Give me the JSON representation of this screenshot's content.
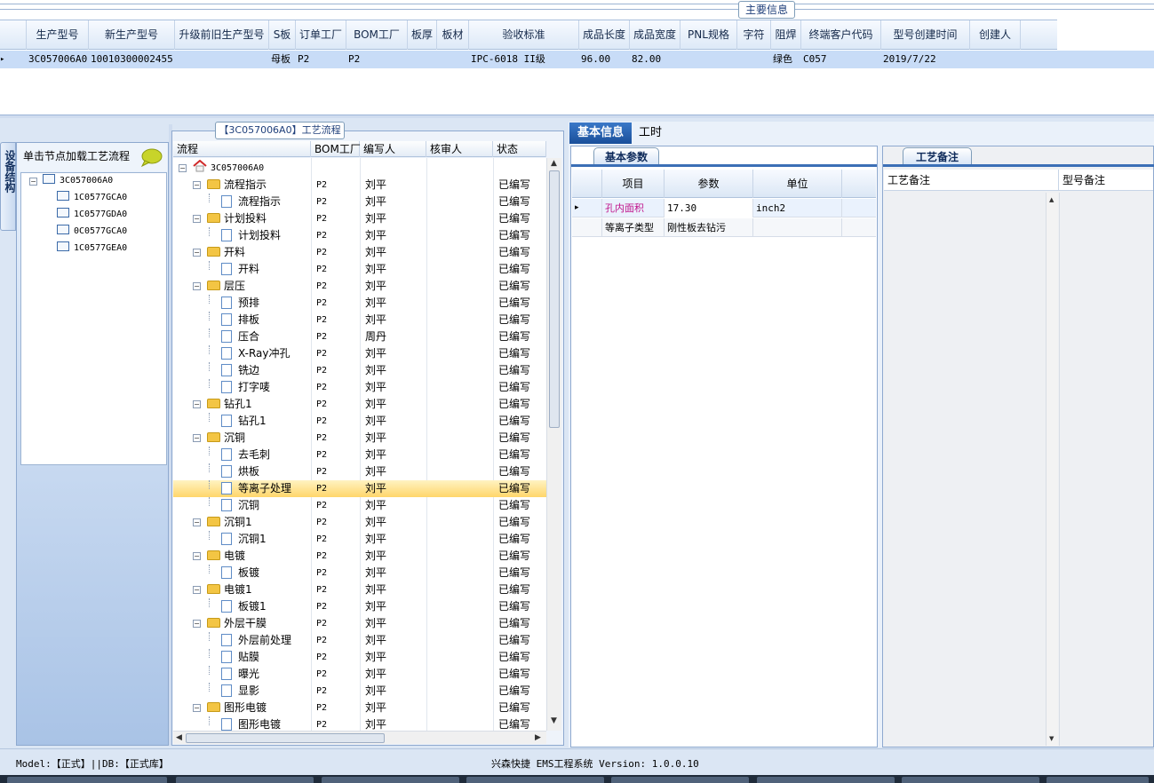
{
  "main_info": {
    "title": "主要信息",
    "columns": [
      "生产型号",
      "新生产型号",
      "升级前旧生产型号",
      "S板",
      "订单工厂",
      "BOM工厂",
      "板厚",
      "板材",
      "验收标准",
      "成品长度",
      "成品宽度",
      "PNL规格",
      "字符",
      "阻焊",
      "终端客户代码",
      "型号创建时间",
      "创建人"
    ],
    "row": {
      "生产型号": "3C057006A0",
      "新生产型号": "10010300002455",
      "升级前旧生产型号": "",
      "S板": "母板",
      "订单工厂": "P2",
      "BOM工厂": "P2",
      "板厚": "",
      "板材": "",
      "验收标准": "IPC-6018 II级",
      "成品长度": "96.00",
      "成品宽度": "82.00",
      "PNL规格": "",
      "字符": "",
      "阻焊": "绿色",
      "终端客户代码": "C057",
      "型号创建时间": "2019/7/22",
      "创建人": ""
    }
  },
  "left_panel": {
    "vertical_tab": "设备结构",
    "hint": "单击节点加载工艺流程",
    "tree": {
      "root": "3C057006A0",
      "children": [
        "1C0577GCA0",
        "1C0577GDA0",
        "0C0577GCA0",
        "1C0577GEA0"
      ]
    }
  },
  "flow": {
    "title": "【3C057006A0】工艺流程",
    "headers": [
      "流程",
      "BOM工厂",
      "编写人",
      "核审人",
      "状态"
    ],
    "root": "3C057006A0",
    "rows": [
      {
        "level": 1,
        "type": "folder",
        "name": "流程指示",
        "bom": "P2",
        "writer": "刘平",
        "reviewer": "",
        "status": "已编写"
      },
      {
        "level": 2,
        "type": "doc",
        "name": "流程指示",
        "bom": "P2",
        "writer": "刘平",
        "reviewer": "",
        "status": "已编写"
      },
      {
        "level": 1,
        "type": "folder",
        "name": "计划投料",
        "bom": "P2",
        "writer": "刘平",
        "reviewer": "",
        "status": "已编写"
      },
      {
        "level": 2,
        "type": "doc",
        "name": "计划投料",
        "bom": "P2",
        "writer": "刘平",
        "reviewer": "",
        "status": "已编写"
      },
      {
        "level": 1,
        "type": "folder",
        "name": "开料",
        "bom": "P2",
        "writer": "刘平",
        "reviewer": "",
        "status": "已编写"
      },
      {
        "level": 2,
        "type": "doc",
        "name": "开料",
        "bom": "P2",
        "writer": "刘平",
        "reviewer": "",
        "status": "已编写"
      },
      {
        "level": 1,
        "type": "folder",
        "name": "层压",
        "bom": "P2",
        "writer": "刘平",
        "reviewer": "",
        "status": "已编写"
      },
      {
        "level": 2,
        "type": "doc",
        "name": "预排",
        "bom": "P2",
        "writer": "刘平",
        "reviewer": "",
        "status": "已编写"
      },
      {
        "level": 2,
        "type": "doc",
        "name": "排板",
        "bom": "P2",
        "writer": "刘平",
        "reviewer": "",
        "status": "已编写"
      },
      {
        "level": 2,
        "type": "doc",
        "name": "压合",
        "bom": "P2",
        "writer": "周丹",
        "reviewer": "",
        "status": "已编写"
      },
      {
        "level": 2,
        "type": "doc",
        "name": "X-Ray冲孔",
        "bom": "P2",
        "writer": "刘平",
        "reviewer": "",
        "status": "已编写"
      },
      {
        "level": 2,
        "type": "doc",
        "name": "铣边",
        "bom": "P2",
        "writer": "刘平",
        "reviewer": "",
        "status": "已编写"
      },
      {
        "level": 2,
        "type": "doc",
        "name": "打字唛",
        "bom": "P2",
        "writer": "刘平",
        "reviewer": "",
        "status": "已编写"
      },
      {
        "level": 1,
        "type": "folder",
        "name": "钻孔1",
        "bom": "P2",
        "writer": "刘平",
        "reviewer": "",
        "status": "已编写"
      },
      {
        "level": 2,
        "type": "doc",
        "name": "钻孔1",
        "bom": "P2",
        "writer": "刘平",
        "reviewer": "",
        "status": "已编写"
      },
      {
        "level": 1,
        "type": "folder",
        "name": "沉铜",
        "bom": "P2",
        "writer": "刘平",
        "reviewer": "",
        "status": "已编写"
      },
      {
        "level": 2,
        "type": "doc",
        "name": "去毛刺",
        "bom": "P2",
        "writer": "刘平",
        "reviewer": "",
        "status": "已编写"
      },
      {
        "level": 2,
        "type": "doc",
        "name": "烘板",
        "bom": "P2",
        "writer": "刘平",
        "reviewer": "",
        "status": "已编写"
      },
      {
        "level": 2,
        "type": "doc",
        "name": "等离子处理",
        "bom": "P2",
        "writer": "刘平",
        "reviewer": "",
        "status": "已编写",
        "selected": true
      },
      {
        "level": 2,
        "type": "doc",
        "name": "沉铜",
        "bom": "P2",
        "writer": "刘平",
        "reviewer": "",
        "status": "已编写"
      },
      {
        "level": 1,
        "type": "folder",
        "name": "沉铜1",
        "bom": "P2",
        "writer": "刘平",
        "reviewer": "",
        "status": "已编写"
      },
      {
        "level": 2,
        "type": "doc",
        "name": "沉铜1",
        "bom": "P2",
        "writer": "刘平",
        "reviewer": "",
        "status": "已编写"
      },
      {
        "level": 1,
        "type": "folder",
        "name": "电镀",
        "bom": "P2",
        "writer": "刘平",
        "reviewer": "",
        "status": "已编写"
      },
      {
        "level": 2,
        "type": "doc",
        "name": "板镀",
        "bom": "P2",
        "writer": "刘平",
        "reviewer": "",
        "status": "已编写"
      },
      {
        "level": 1,
        "type": "folder",
        "name": "电镀1",
        "bom": "P2",
        "writer": "刘平",
        "reviewer": "",
        "status": "已编写"
      },
      {
        "level": 2,
        "type": "doc",
        "name": "板镀1",
        "bom": "P2",
        "writer": "刘平",
        "reviewer": "",
        "status": "已编写"
      },
      {
        "level": 1,
        "type": "folder",
        "name": "外层干膜",
        "bom": "P2",
        "writer": "刘平",
        "reviewer": "",
        "status": "已编写"
      },
      {
        "level": 2,
        "type": "doc",
        "name": "外层前处理",
        "bom": "P2",
        "writer": "刘平",
        "reviewer": "",
        "status": "已编写"
      },
      {
        "level": 2,
        "type": "doc",
        "name": "贴膜",
        "bom": "P2",
        "writer": "刘平",
        "reviewer": "",
        "status": "已编写"
      },
      {
        "level": 2,
        "type": "doc",
        "name": "曝光",
        "bom": "P2",
        "writer": "刘平",
        "reviewer": "",
        "status": "已编写"
      },
      {
        "level": 2,
        "type": "doc",
        "name": "显影",
        "bom": "P2",
        "writer": "刘平",
        "reviewer": "",
        "status": "已编写"
      },
      {
        "level": 1,
        "type": "folder",
        "name": "图形电镀",
        "bom": "P2",
        "writer": "刘平",
        "reviewer": "",
        "status": "已编写"
      },
      {
        "level": 2,
        "type": "doc",
        "name": "图形电镀",
        "bom": "P2",
        "writer": "刘平",
        "reviewer": "",
        "status": "已编写"
      }
    ]
  },
  "detail": {
    "tabs": [
      "基本信息",
      "工时"
    ],
    "basic_params": {
      "tab": "基本参数",
      "headers": [
        "项目",
        "参数",
        "单位"
      ],
      "rows": [
        {
          "item": "孔内面积",
          "value": "17.30",
          "unit": "inch2",
          "item_color": "#c0148c"
        },
        {
          "item": "等离子类型",
          "value": "刚性板去钻污",
          "unit": ""
        }
      ]
    },
    "notes": {
      "tab": "工艺备注",
      "headers": [
        "工艺备注",
        "型号备注"
      ]
    }
  },
  "status_bar": {
    "left": "Model:【正式】||DB:【正式库】",
    "center": "兴森快捷 EMS工程系统 Version: 1.0.0.10"
  }
}
